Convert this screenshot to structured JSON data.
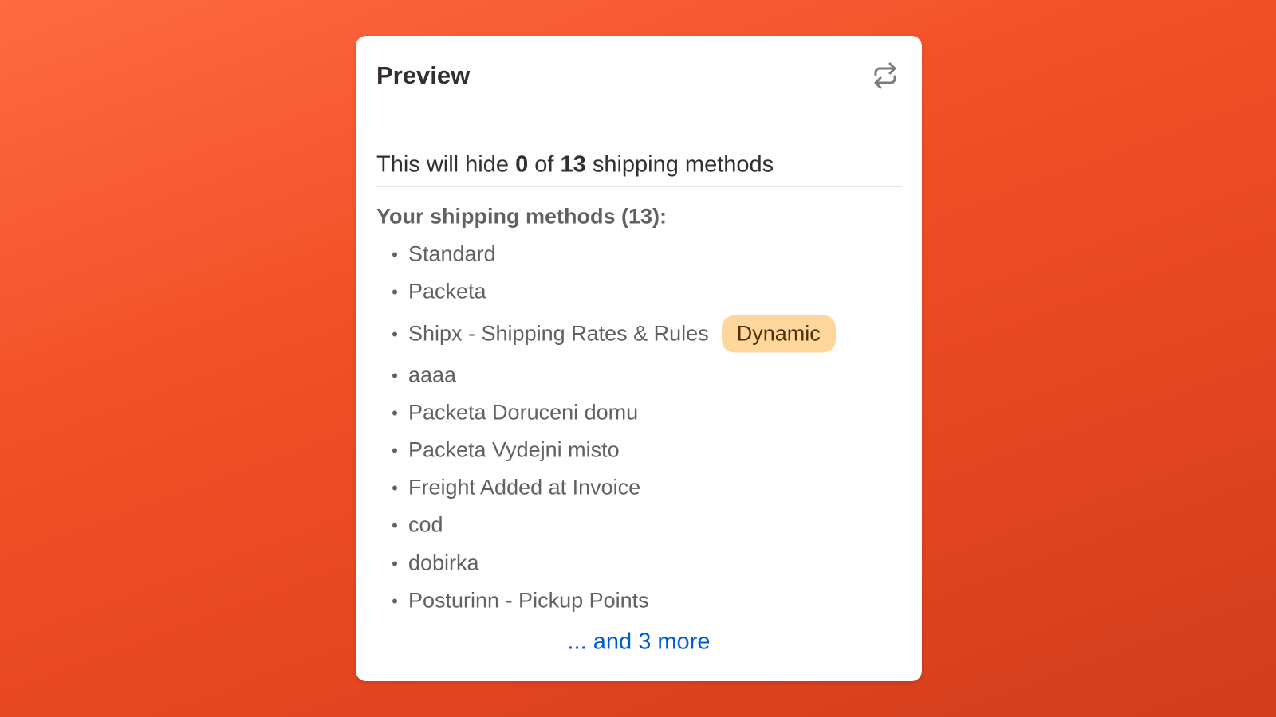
{
  "card": {
    "title": "Preview",
    "refresh_icon": "refresh-icon",
    "summary": {
      "prefix": "This will hide ",
      "hidden": "0",
      "middle": " of ",
      "total": "13",
      "suffix": " shipping methods"
    },
    "list_heading": "Your shipping methods (13):",
    "methods": [
      {
        "name": "Standard"
      },
      {
        "name": "Packeta"
      },
      {
        "name": "Shipx - Shipping Rates & Rules",
        "badge": "Dynamic"
      },
      {
        "name": "aaaa"
      },
      {
        "name": "Packeta Doruceni domu"
      },
      {
        "name": "Packeta Vydejni misto"
      },
      {
        "name": "Freight Added at Invoice"
      },
      {
        "name": "cod"
      },
      {
        "name": "dobirka"
      },
      {
        "name": "Posturinn - Pickup Points"
      }
    ],
    "more_link": "... and 3 more"
  },
  "colors": {
    "background": "#f04e26",
    "badge_bg": "#ffd79d",
    "link": "#005bd3"
  }
}
